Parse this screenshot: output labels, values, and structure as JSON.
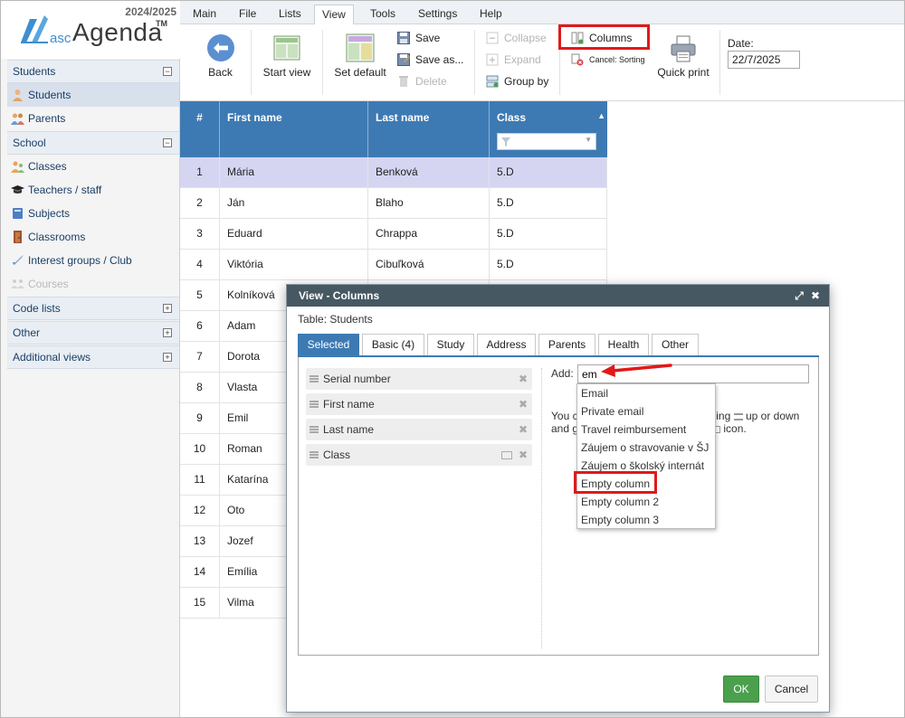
{
  "app": {
    "year": "2024/2025",
    "logo_asc": "asc",
    "logo_name": "Agenda",
    "logo_tm": "TM"
  },
  "sidebar": {
    "sections": [
      {
        "label": "Students",
        "toggle": "−"
      },
      {
        "label": "School",
        "toggle": "−"
      },
      {
        "label": "Code lists",
        "toggle": "+"
      },
      {
        "label": "Other",
        "toggle": "+"
      },
      {
        "label": "Additional views",
        "toggle": "+"
      }
    ],
    "students_items": [
      {
        "label": "Students",
        "icon": "student-icon"
      },
      {
        "label": "Parents",
        "icon": "parents-icon"
      }
    ],
    "school_items": [
      {
        "label": "Classes",
        "icon": "classes-icon"
      },
      {
        "label": "Teachers / staff",
        "icon": "graduation-cap-icon"
      },
      {
        "label": "Subjects",
        "icon": "book-icon"
      },
      {
        "label": "Classrooms",
        "icon": "door-icon"
      },
      {
        "label": "Interest groups / Club",
        "icon": "rocket-icon"
      },
      {
        "label": "Courses",
        "icon": "courses-icon"
      }
    ]
  },
  "menu": [
    "Main",
    "File",
    "Lists",
    "View",
    "Tools",
    "Settings",
    "Help"
  ],
  "toolbar": {
    "back": "Back",
    "start_view": "Start view",
    "set_default": "Set default",
    "save": "Save",
    "save_as": "Save as...",
    "delete": "Delete",
    "collapse": "Collapse",
    "expand": "Expand",
    "group_by": "Group by",
    "columns": "Columns",
    "cancel_sorting": "Cancel: Sorting",
    "quick_print": "Quick print",
    "date_label": "Date:",
    "date_value": "22/7/2025"
  },
  "grid": {
    "headers": [
      "#",
      "First name",
      "Last name",
      "Class"
    ],
    "rows": [
      {
        "n": "1",
        "first": "Mária",
        "last": "Benková",
        "cls": "5.D"
      },
      {
        "n": "2",
        "first": "Ján",
        "last": "Blaho",
        "cls": "5.D"
      },
      {
        "n": "3",
        "first": "Eduard",
        "last": "Chrappa",
        "cls": "5.D"
      },
      {
        "n": "4",
        "first": "Viktória",
        "last": "Cibuľková",
        "cls": "5.D"
      },
      {
        "n": "5",
        "first": "Kolníková",
        "last": "",
        "cls": ""
      },
      {
        "n": "6",
        "first": "Adam",
        "last": "",
        "cls": ""
      },
      {
        "n": "7",
        "first": "Dorota",
        "last": "",
        "cls": ""
      },
      {
        "n": "8",
        "first": "Vlasta",
        "last": "",
        "cls": ""
      },
      {
        "n": "9",
        "first": "Emil",
        "last": "",
        "cls": ""
      },
      {
        "n": "10",
        "first": "Roman",
        "last": "",
        "cls": ""
      },
      {
        "n": "11",
        "first": "Katarína",
        "last": "",
        "cls": ""
      },
      {
        "n": "12",
        "first": "Oto",
        "last": "",
        "cls": ""
      },
      {
        "n": "13",
        "first": "Jozef",
        "last": "",
        "cls": ""
      },
      {
        "n": "14",
        "first": "Emília",
        "last": "",
        "cls": ""
      },
      {
        "n": "15",
        "first": "Vilma",
        "last": "",
        "cls": ""
      }
    ]
  },
  "dialog": {
    "title": "View - Columns",
    "table_label": "Table: Students",
    "tabs": [
      "Selected",
      "Basic (4)",
      "Study",
      "Address",
      "Parents",
      "Health",
      "Other"
    ],
    "selected_columns": [
      "Serial number",
      "First name",
      "Last name",
      "Class"
    ],
    "add_label": "Add:",
    "add_value": "em",
    "hint_line1": "You c",
    "hint_mid1": "ging",
    "hint_end1": "up or down",
    "hint_line2": "and g",
    "hint_end2": "icon.",
    "dropdown": [
      "Email",
      "Private email",
      "Travel reimbursement",
      "Záujem o stravovanie v ŠJ",
      "Záujem o školský internát",
      "Empty column",
      "Empty column 2",
      "Empty column 3"
    ],
    "ok": "OK",
    "cancel": "Cancel"
  },
  "colors": {
    "accent": "#3d7ab4",
    "highlight": "#e01919",
    "ok_green": "#4aa04c",
    "dialog_title": "#465862",
    "row_selected": "#d5d5f2"
  }
}
